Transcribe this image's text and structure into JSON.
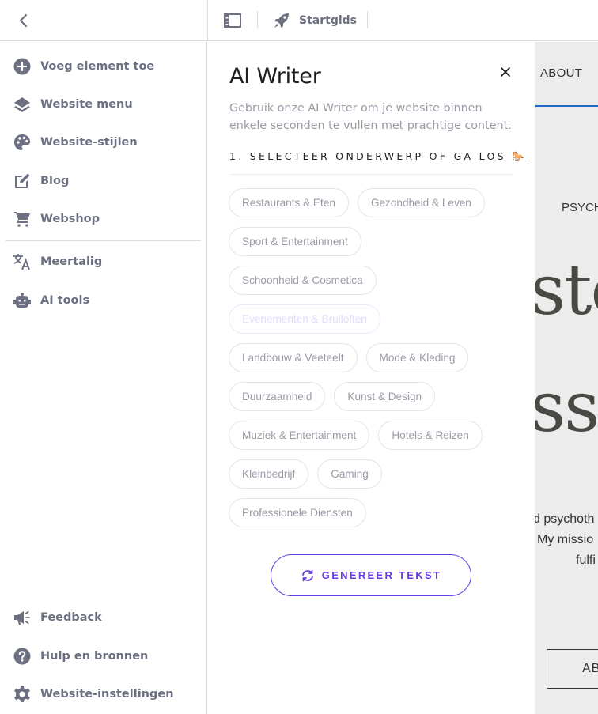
{
  "topbar": {
    "back_icon": "chevron-left-icon",
    "layout_icon": "sidebar-layout-icon",
    "guide_icon": "rocket-icon",
    "guide_label": "Startgids"
  },
  "sidebar": {
    "items": [
      {
        "label": "Voeg element toe",
        "icon": "plus-circle-icon"
      },
      {
        "label": "Website menu",
        "icon": "layers-icon"
      },
      {
        "label": "Website-stijlen",
        "icon": "palette-icon"
      },
      {
        "label": "Blog",
        "icon": "edit-icon"
      },
      {
        "label": "Webshop",
        "icon": "cart-icon"
      },
      {
        "label": "Meertalig",
        "icon": "translate-icon"
      },
      {
        "label": "AI tools",
        "icon": "robot-icon"
      }
    ],
    "bottom_items": [
      {
        "label": "Feedback",
        "icon": "megaphone-icon"
      },
      {
        "label": "Hulp en bronnen",
        "icon": "help-circle-icon"
      },
      {
        "label": "Website-instellingen",
        "icon": "gear-icon"
      }
    ]
  },
  "ai_writer": {
    "title": "AI Writer",
    "close_icon": "close-icon",
    "description": "Gebruik onze AI Writer om je website binnen enkele seconden te vullen met prachtige content.",
    "step_label": "1. SELECTEER ONDERWERP OF ",
    "step_link": "GA LOS",
    "step_emoji": "🐎",
    "topics": [
      "Restaurants & Eten",
      "Gezondheid & Leven",
      "Sport & Entertainment",
      "Schoonheid & Cosmetica",
      "Evenementen & Bruiloften",
      "Landbouw & Veeteelt",
      "Mode & Kleding",
      "Duurzaamheid",
      "Kunst & Design",
      "Muziek & Entertainment",
      "Hotels & Reizen",
      "Kleinbedrijf",
      "Gaming",
      "Professionele Diensten"
    ],
    "generate_label": "GENEREER TEKST",
    "generate_icon": "refresh-icon",
    "accent_color": "#673de6"
  },
  "preview": {
    "nav_label": "ABOUT",
    "eyebrow": "PSYCH",
    "headline_1": "ste",
    "headline_2": "sse",
    "body_lines": [
      "d psychoth",
      "My missio",
      "fulfi"
    ],
    "cta_label": "AB"
  }
}
